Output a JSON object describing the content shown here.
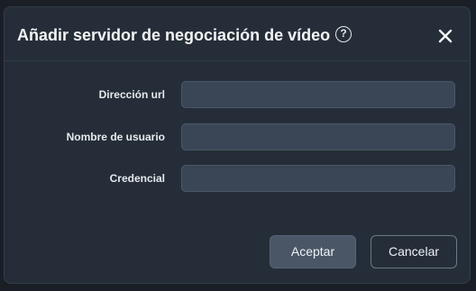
{
  "dialog": {
    "title": "Añadir servidor de negociación de vídeo",
    "help_glyph": "?",
    "help_icon": "help-circle-icon",
    "close_icon": "close-icon"
  },
  "form": {
    "fields": [
      {
        "label": "Dirección url",
        "value": "",
        "placeholder": ""
      },
      {
        "label": "Nombre de usuario",
        "value": "",
        "placeholder": ""
      },
      {
        "label": "Credencial",
        "value": "",
        "placeholder": ""
      }
    ]
  },
  "buttons": {
    "accept_label": "Aceptar",
    "cancel_label": "Cancelar"
  },
  "colors": {
    "dialog_bg": "#252e38",
    "input_bg": "#3a4656",
    "accept_bg": "#4a5666",
    "text": "#f3f5f7"
  }
}
